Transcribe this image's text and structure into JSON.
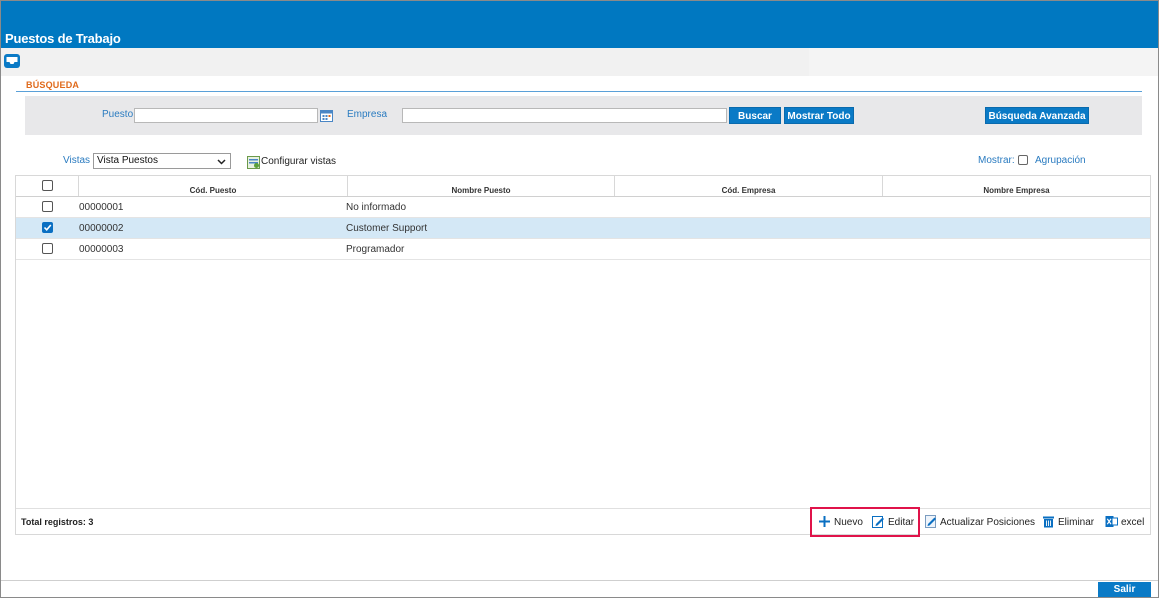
{
  "window": {
    "title": "Puestos de Trabajo"
  },
  "search": {
    "legend": "BÚSQUEDA",
    "puesto_label": "Puesto",
    "puesto_value": "",
    "empresa_label": "Empresa",
    "empresa_value": "",
    "buscar_label": "Buscar",
    "mostrar_todo_label": "Mostrar Todo",
    "avanzada_label": "Búsqueda Avanzada"
  },
  "views": {
    "label": "Vistas",
    "selected": "Vista Puestos",
    "configure_label": "Configurar vistas"
  },
  "display": {
    "show_label": "Mostrar:",
    "grouping_label": "Agrupación",
    "grouping_checked": false
  },
  "table": {
    "columns": [
      "Cód. Puesto",
      "Nombre Puesto",
      "Cód. Empresa",
      "Nombre Empresa"
    ],
    "rows": [
      {
        "checked": false,
        "cod_puesto": "00000001",
        "nombre_puesto": "No informado",
        "cod_empresa": "",
        "nombre_empresa": ""
      },
      {
        "checked": true,
        "cod_puesto": "00000002",
        "nombre_puesto": "Customer Support",
        "cod_empresa": "",
        "nombre_empresa": ""
      },
      {
        "checked": false,
        "cod_puesto": "00000003",
        "nombre_puesto": "Programador",
        "cod_empresa": "",
        "nombre_empresa": ""
      }
    ]
  },
  "footer": {
    "total_label": "Total registros: 3",
    "actions": {
      "nuevo": "Nuevo",
      "editar": "Editar",
      "actualizar": "Actualizar Posiciones",
      "eliminar": "Eliminar",
      "excel": "excel"
    }
  },
  "exit_label": "Salir",
  "colors": {
    "titlebar": "#0078c1",
    "accent": "#0a7ac6",
    "label_blue": "#2a7bc0",
    "legend_orange": "#e06a1b",
    "selected_row": "#d4e8f6",
    "highlight": "#e0134a"
  }
}
